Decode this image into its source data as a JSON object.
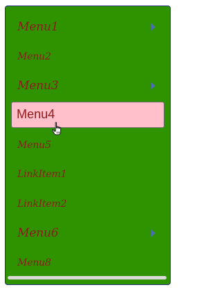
{
  "menu": {
    "items": [
      {
        "label": "Menu1",
        "has_submenu": true
      },
      {
        "label": "Menu2",
        "has_submenu": false
      },
      {
        "label": "Menu3",
        "has_submenu": true
      },
      {
        "label": "Menu4",
        "has_submenu": false,
        "state": "hover"
      },
      {
        "label": "Menu5",
        "has_submenu": false
      },
      {
        "label": "LinkItem1",
        "has_submenu": false
      },
      {
        "label": "LinkItem2",
        "has_submenu": false
      },
      {
        "label": "Menu6",
        "has_submenu": true
      },
      {
        "label": "Menu8",
        "has_submenu": false
      }
    ]
  },
  "colors": {
    "panel_bg": "#2f9300",
    "text": "#8e1b1b",
    "hover_bg": "#ffc0cb",
    "arrow": "#4a6eb4"
  },
  "icons": {
    "submenu": "chevron-right-icon",
    "cursor": "hand-pointer-cursor"
  }
}
